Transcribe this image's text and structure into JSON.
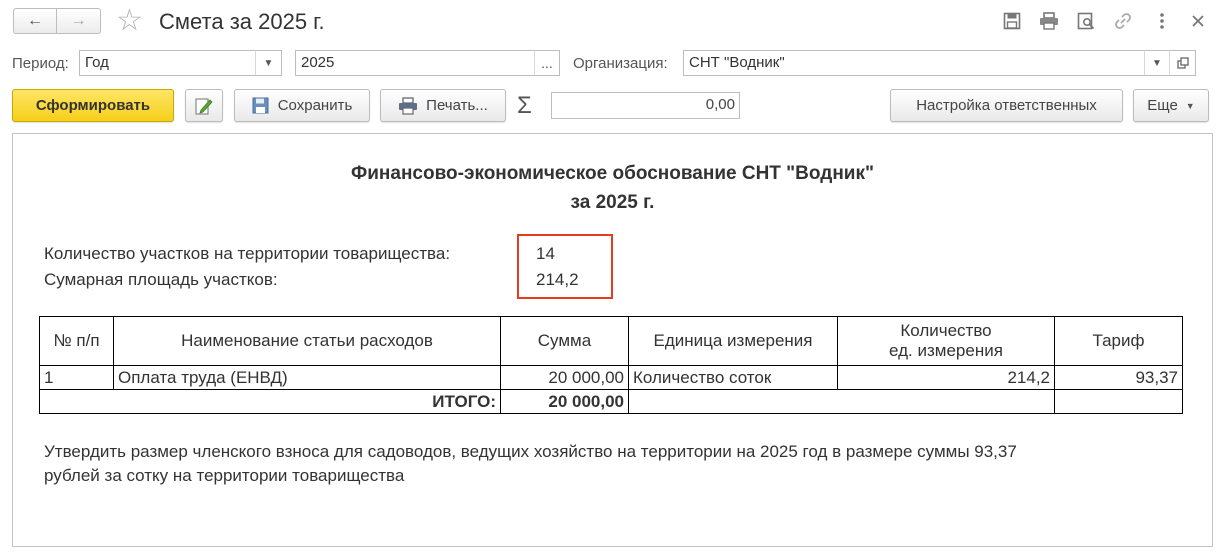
{
  "window": {
    "title": "Смета за 2025 г.",
    "nav_back": "←",
    "nav_forward": "→",
    "favorite": "☆",
    "icons": [
      "save-icon",
      "print-icon",
      "preview-icon",
      "link-icon",
      "more-vert-icon",
      "close-icon"
    ]
  },
  "form": {
    "period_label": "Период:",
    "period_type": "Год",
    "period_value": "2025",
    "period_select": "...",
    "org_label": "Организация:",
    "org_value": "СНТ \"Водник\""
  },
  "toolbar": {
    "generate": "Сформировать",
    "save": "Сохранить",
    "print": "Печать...",
    "sum_value": "0,00",
    "responsible": "Настройка ответственных",
    "more": "Еще"
  },
  "report": {
    "title_line1": "Финансово-экономическое обоснование СНТ \"Водник\"",
    "title_line2": "за 2025 г.",
    "plots_label": "Количество участков на территории товарищества:",
    "plots_value": "14",
    "area_label": "Сумарная площадь участков:",
    "area_value": "214,2",
    "columns": {
      "num": "№ п/п",
      "name": "Наименование статьи расходов",
      "sum": "Сумма",
      "unit": "Единица измерения",
      "qty_line1": "Количество",
      "qty_line2": "ед. измерения",
      "tariff": "Тариф"
    },
    "rows": [
      {
        "num": "1",
        "name": "Оплата труда (ЕНВД)",
        "sum": "20 000,00",
        "unit": "Количество соток",
        "qty": "214,2",
        "tariff": "93,37"
      }
    ],
    "total_label": "ИТОГО:",
    "total_sum": "20 000,00",
    "conclusion_line1": "Утвердить размер членского взноса для садоводов, ведущих хозяйство на территории на 2025 год в размере суммы 93,37",
    "conclusion_line2": "рублей за сотку на территории товарищества"
  }
}
